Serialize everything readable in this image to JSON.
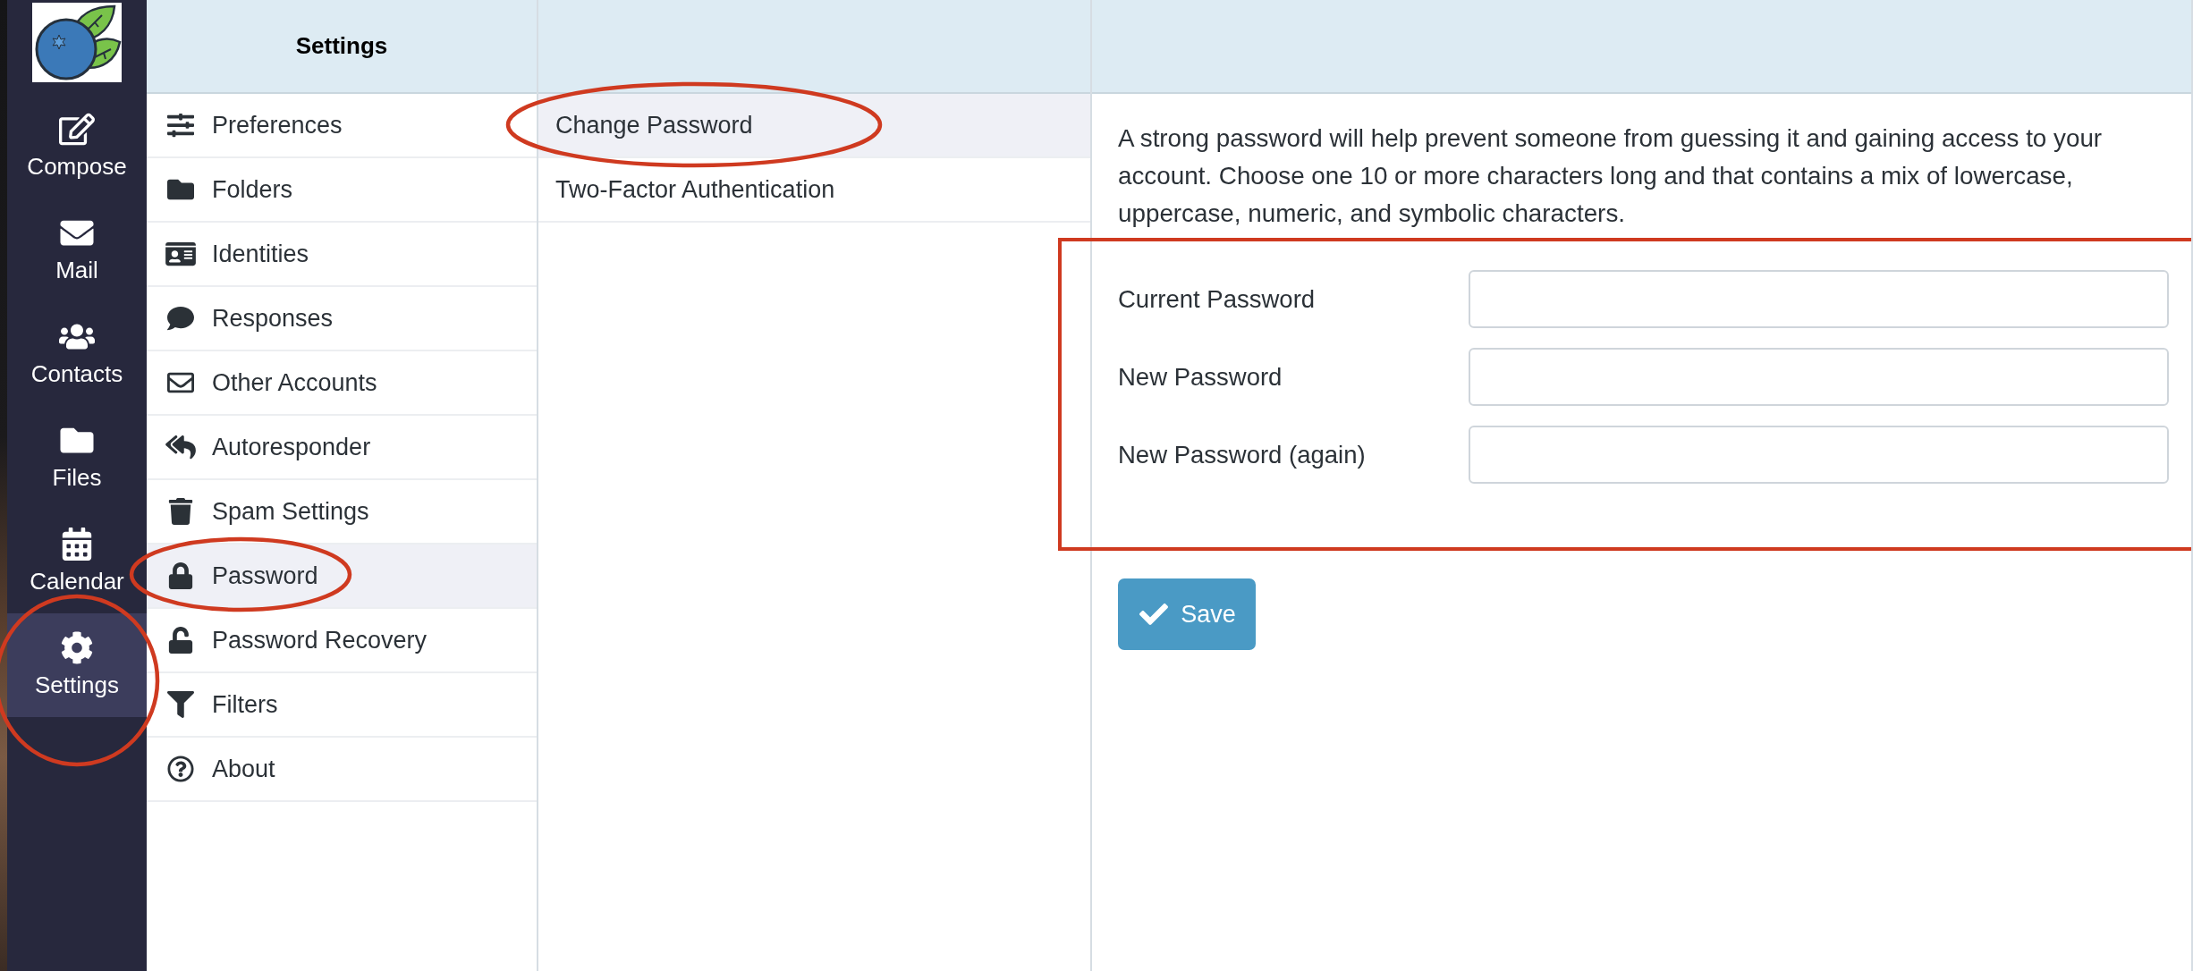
{
  "nav": {
    "items": [
      {
        "label": "Compose",
        "selected": false,
        "circled": false
      },
      {
        "label": "Mail",
        "selected": false,
        "circled": false
      },
      {
        "label": "Contacts",
        "selected": false,
        "circled": false
      },
      {
        "label": "Files",
        "selected": false,
        "circled": false
      },
      {
        "label": "Calendar",
        "selected": false,
        "circled": false
      },
      {
        "label": "Settings",
        "selected": true,
        "circled": true
      }
    ]
  },
  "settings_menu": {
    "title": "Settings",
    "items": [
      {
        "label": "Preferences",
        "selected": false,
        "circled": false
      },
      {
        "label": "Folders",
        "selected": false,
        "circled": false
      },
      {
        "label": "Identities",
        "selected": false,
        "circled": false
      },
      {
        "label": "Responses",
        "selected": false,
        "circled": false
      },
      {
        "label": "Other Accounts",
        "selected": false,
        "circled": false
      },
      {
        "label": "Autoresponder",
        "selected": false,
        "circled": false
      },
      {
        "label": "Spam Settings",
        "selected": false,
        "circled": false
      },
      {
        "label": "Password",
        "selected": true,
        "circled": true
      },
      {
        "label": "Password Recovery",
        "selected": false,
        "circled": false
      },
      {
        "label": "Filters",
        "selected": false,
        "circled": false
      },
      {
        "label": "About",
        "selected": false,
        "circled": false
      }
    ]
  },
  "submenu": {
    "items": [
      {
        "label": "Change Password",
        "selected": true,
        "circled": true
      },
      {
        "label": "Two-Factor Authentication",
        "selected": false,
        "circled": false
      }
    ]
  },
  "content": {
    "description": "A strong password will help prevent someone from guessing it and gaining access to your account. Choose one 10 or more characters long and that contains a mix of lowercase, uppercase, numeric, and symbolic characters.",
    "form": {
      "outlined": true,
      "fields": [
        {
          "label": "Current Password"
        },
        {
          "label": "New Password"
        },
        {
          "label": "New Password (again)"
        }
      ]
    },
    "save_button": {
      "label": "Save"
    }
  }
}
